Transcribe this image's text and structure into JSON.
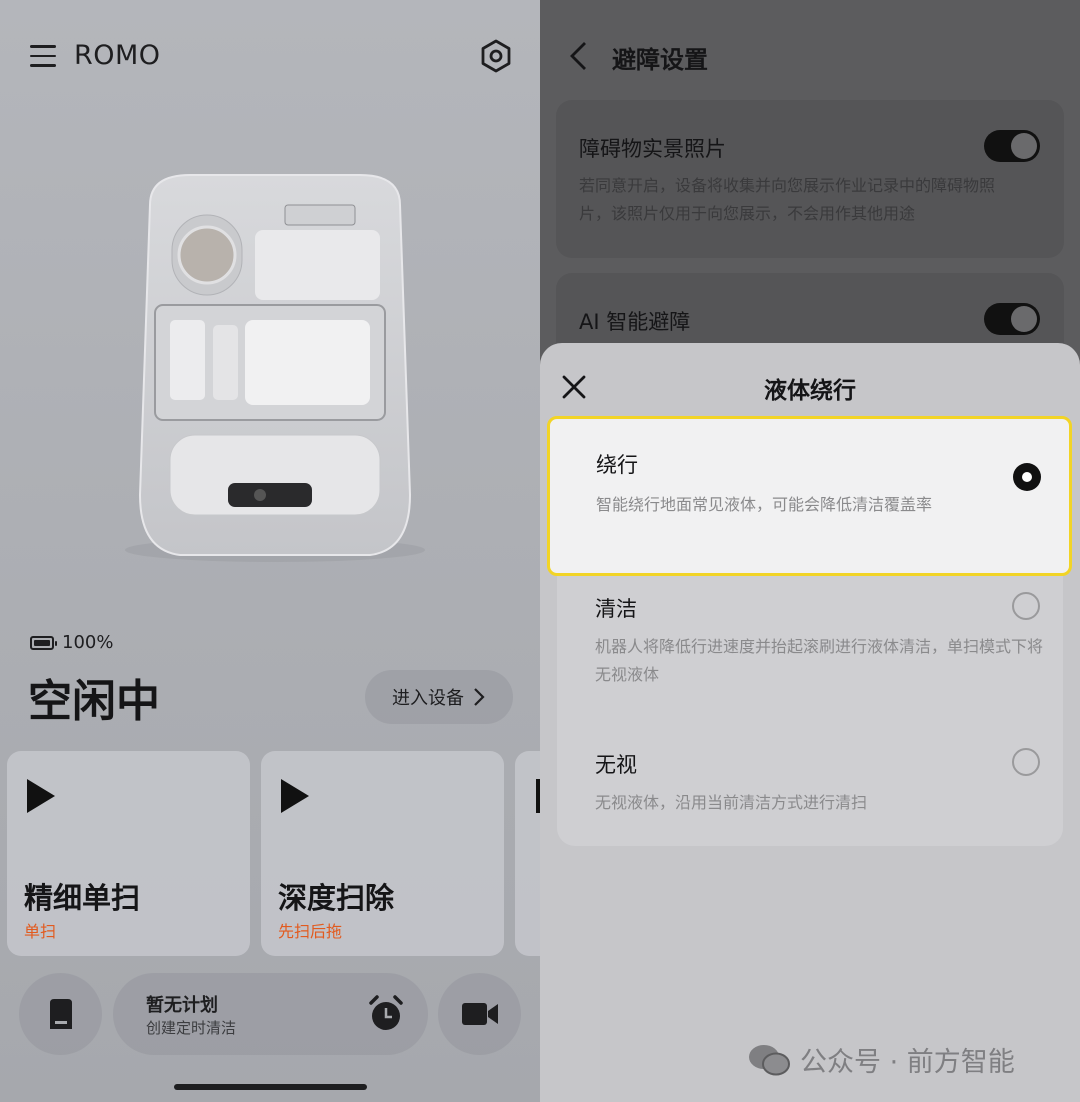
{
  "left": {
    "brand": "ROMO",
    "battery": "100%",
    "status": "空闲中",
    "enter_button": "进入设备",
    "cards": [
      {
        "title": "精细单扫",
        "subtitle": "单扫"
      },
      {
        "title": "深度扫除",
        "subtitle": "先扫后拖"
      }
    ],
    "plan": {
      "title": "暂无计划",
      "subtitle": "创建定时清洁"
    },
    "icons": [
      "menu-icon",
      "settings-icon",
      "battery-icon",
      "play-icon",
      "dock-icon",
      "alarm-clock-icon",
      "video-camera-icon"
    ],
    "subtitle_color": "#e25a1e"
  },
  "right": {
    "page_title": "避障设置",
    "settings": [
      {
        "title": "障碍物实景照片",
        "desc": "若同意开启，设备将收集并向您展示作业记录中的障碍物照片，该照片仅用于向您展示，不会用作其他用途",
        "enabled": true
      },
      {
        "title": "AI 智能避障",
        "enabled": true
      }
    ],
    "sheet": {
      "title": "液体绕行",
      "options": [
        {
          "title": "绕行",
          "desc": "智能绕行地面常见液体，可能会降低清洁覆盖率",
          "selected": true
        },
        {
          "title": "清洁",
          "desc": "机器人将降低行进速度并抬起滚刷进行液体清洁，单扫模式下将无视液体",
          "selected": false
        },
        {
          "title": "无视",
          "desc": "无视液体，沿用当前清洁方式进行清扫",
          "selected": false
        }
      ]
    },
    "watermark": "公众号 · 前方智能",
    "highlight_color": "#f2d426"
  }
}
